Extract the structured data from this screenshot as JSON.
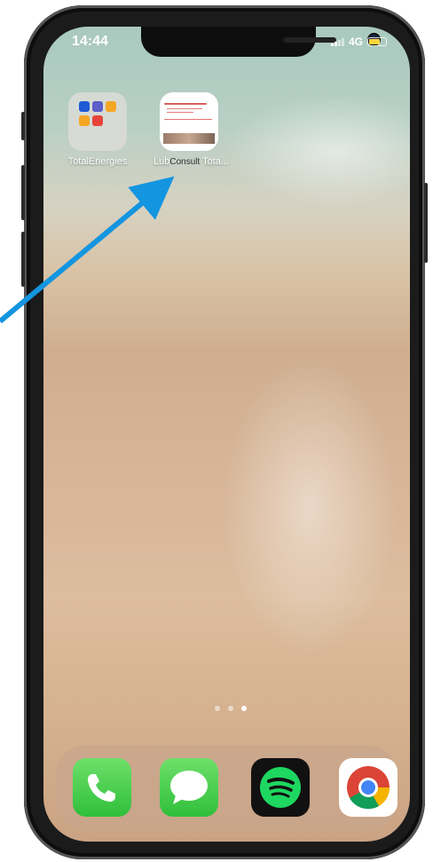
{
  "status_bar": {
    "time": "14:44",
    "network": "4G"
  },
  "home_screen": {
    "apps": [
      {
        "label": "TotalEnergies",
        "type": "folder"
      },
      {
        "label": "Lub",
        "type": "web-clip",
        "overlay_text": "Consult",
        "suffix": " Tota..."
      }
    ],
    "page_dots": {
      "count": 3,
      "active_index": 2
    }
  },
  "dock": {
    "apps": [
      {
        "name": "Phone",
        "icon": "phone-icon"
      },
      {
        "name": "Messages",
        "icon": "message-bubble-icon"
      },
      {
        "name": "Spotify",
        "icon": "spotify-icon"
      },
      {
        "name": "Chrome",
        "icon": "chrome-icon"
      }
    ]
  },
  "colors": {
    "annotation_arrow": "#1495e0",
    "battery": "#ffd43b",
    "dock_green": "#34c759"
  }
}
